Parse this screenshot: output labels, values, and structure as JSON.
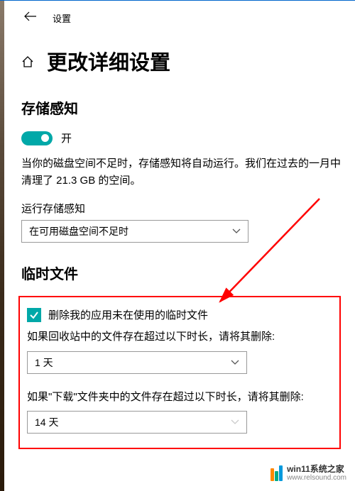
{
  "header": {
    "title": "设置"
  },
  "page": {
    "title": "更改详细设置"
  },
  "storage_sense": {
    "section_title": "存储感知",
    "toggle_label": "开",
    "description": "当你的磁盘空间不足时，存储感知将自动运行。我们在过去的一月中清理了 21.3 GB 的空间。",
    "run_label": "运行存储感知",
    "run_value": "在可用磁盘空间不足时"
  },
  "temp_files": {
    "section_title": "临时文件",
    "checkbox_label": "删除我的应用未在使用的临时文件",
    "recycle_label": "如果回收站中的文件存在超过以下时长，请将其删除:",
    "recycle_value": "1 天",
    "downloads_label": "如果\"下载\"文件夹中的文件存在超过以下时长，请将其删除:",
    "downloads_value": "14 天"
  },
  "watermark": {
    "line1": "win11系统之家",
    "line2": "www.relsound.com"
  }
}
